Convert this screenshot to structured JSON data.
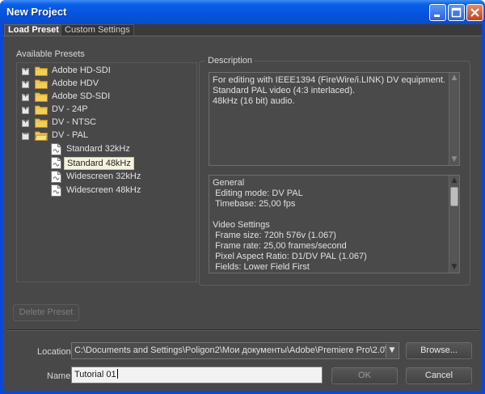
{
  "window": {
    "title": "New Project"
  },
  "tabs": [
    {
      "label": "Load Preset"
    },
    {
      "label": "Custom Settings"
    }
  ],
  "available_presets": {
    "heading": "Available Presets",
    "items": [
      {
        "label": "Adobe HD-SDI",
        "expander": "+"
      },
      {
        "label": "Adobe HDV",
        "expander": "+"
      },
      {
        "label": "Adobe SD-SDI",
        "expander": "+"
      },
      {
        "label": "DV - 24P",
        "expander": "+"
      },
      {
        "label": "DV - NTSC",
        "expander": "+"
      },
      {
        "label": "DV - PAL",
        "expander": "−"
      }
    ],
    "children": [
      {
        "label": "Standard 32kHz"
      },
      {
        "label": "Standard 48kHz"
      },
      {
        "label": "Widescreen 32kHz"
      },
      {
        "label": "Widescreen 48kHz"
      }
    ]
  },
  "description": {
    "heading": "Description",
    "text": "For editing with IEEE1394 (FireWire/i.LINK) DV equipment.\nStandard PAL video (4:3 interlaced).\n48kHz (16 bit) audio.",
    "details": "General\n Editing mode: DV PAL\n Timebase: 25,00 fps\n\nVideo Settings\n Frame size: 720h 576v (1.067)\n Frame rate: 25,00 frames/second\n Pixel Aspect Ratio: D1/DV PAL (1.067)\n Fields: Lower Field First"
  },
  "buttons": {
    "delete_preset": "Delete Preset",
    "browse": "Browse...",
    "ok": "OK",
    "cancel": "Cancel"
  },
  "location": {
    "label": "Location:",
    "value": "C:\\Documents and Settings\\Poligon2\\Мои документы\\Adobe\\Premiere Pro\\2.0\\"
  },
  "name": {
    "label": "Name:",
    "value": "Tutorial 01"
  }
}
